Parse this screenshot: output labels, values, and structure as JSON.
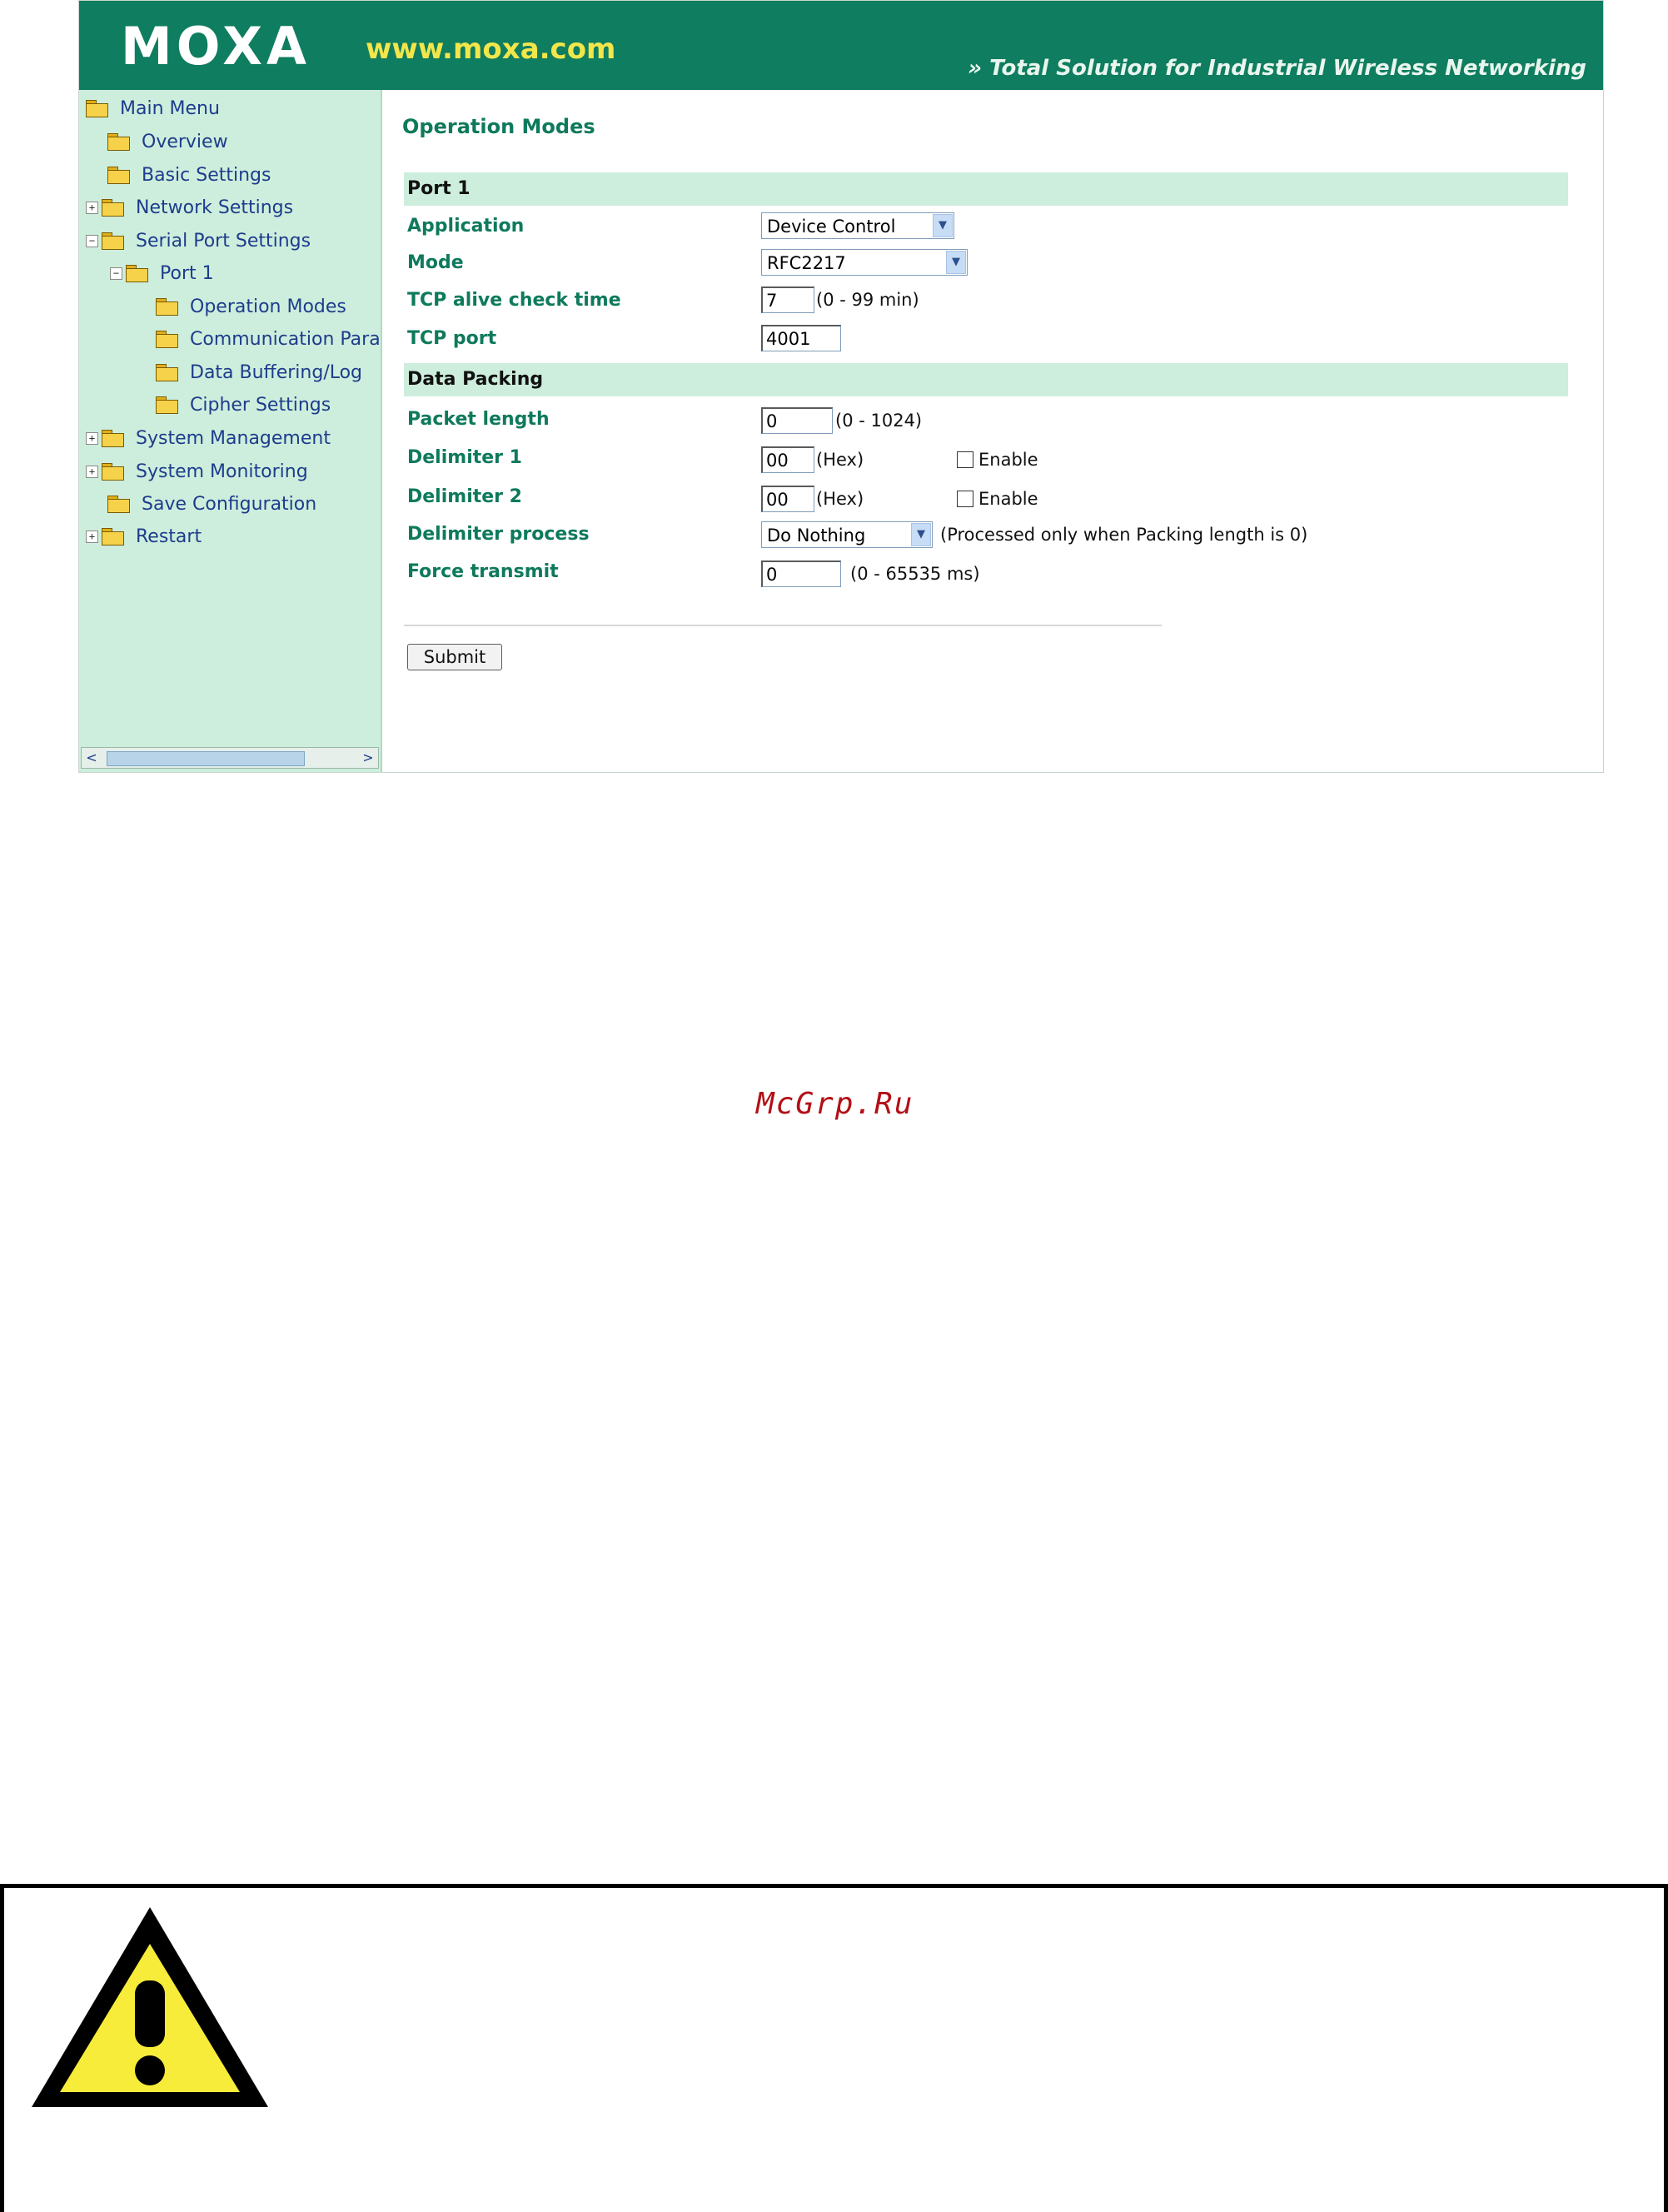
{
  "header": {
    "logo": "MOXA",
    "url": "www.moxa.com",
    "tagline": "» Total Solution for Industrial Wireless Networking"
  },
  "nav": {
    "items": [
      {
        "label": "Main Menu",
        "expander": ""
      },
      {
        "label": "Overview",
        "expander": ""
      },
      {
        "label": "Basic Settings",
        "expander": ""
      },
      {
        "label": "Network Settings",
        "expander": "+"
      },
      {
        "label": "Serial Port Settings",
        "expander": "−"
      },
      {
        "label": "Port 1",
        "expander": "−"
      },
      {
        "label": "Operation Modes",
        "expander": ""
      },
      {
        "label": "Communication Para",
        "expander": ""
      },
      {
        "label": "Data Buffering/Log",
        "expander": ""
      },
      {
        "label": "Cipher Settings",
        "expander": ""
      },
      {
        "label": "System Management",
        "expander": "+"
      },
      {
        "label": "System Monitoring",
        "expander": "+"
      },
      {
        "label": "Save Configuration",
        "expander": ""
      },
      {
        "label": "Restart",
        "expander": "+"
      }
    ],
    "scroll_left": "<",
    "scroll_right": ">"
  },
  "main": {
    "title": "Operation Modes",
    "port_section": "Port 1",
    "application": {
      "label": "Application",
      "value": "Device Control"
    },
    "mode": {
      "label": "Mode",
      "value": "RFC2217"
    },
    "tcp_alive": {
      "label": "TCP alive check time",
      "value": "7",
      "hint": "(0 - 99 min)"
    },
    "tcp_port": {
      "label": "TCP port",
      "value": "4001"
    },
    "packing_section": "Data Packing",
    "packet_length": {
      "label": "Packet length",
      "value": "0",
      "hint": "(0 - 1024)"
    },
    "delimiter1": {
      "label": "Delimiter 1",
      "value": "00",
      "hint": "(Hex)",
      "enable": "Enable"
    },
    "delimiter2": {
      "label": "Delimiter 2",
      "value": "00",
      "hint": "(Hex)",
      "enable": "Enable"
    },
    "delimiter_process": {
      "label": "Delimiter process",
      "value": "Do Nothing",
      "hint": "(Processed only when Packing length is 0)"
    },
    "force_transmit": {
      "label": "Force transmit",
      "value": "0",
      "hint": "(0 - 65535 ms)"
    },
    "submit": "Submit"
  },
  "watermark": "McGrp.Ru",
  "colors": {
    "banner": "#0f7d5f",
    "nav_bg": "#cdeedc",
    "label_green": "#0e7a5c",
    "link_blue": "#1e3c8c",
    "warning_yellow": "#f7ec3a"
  }
}
